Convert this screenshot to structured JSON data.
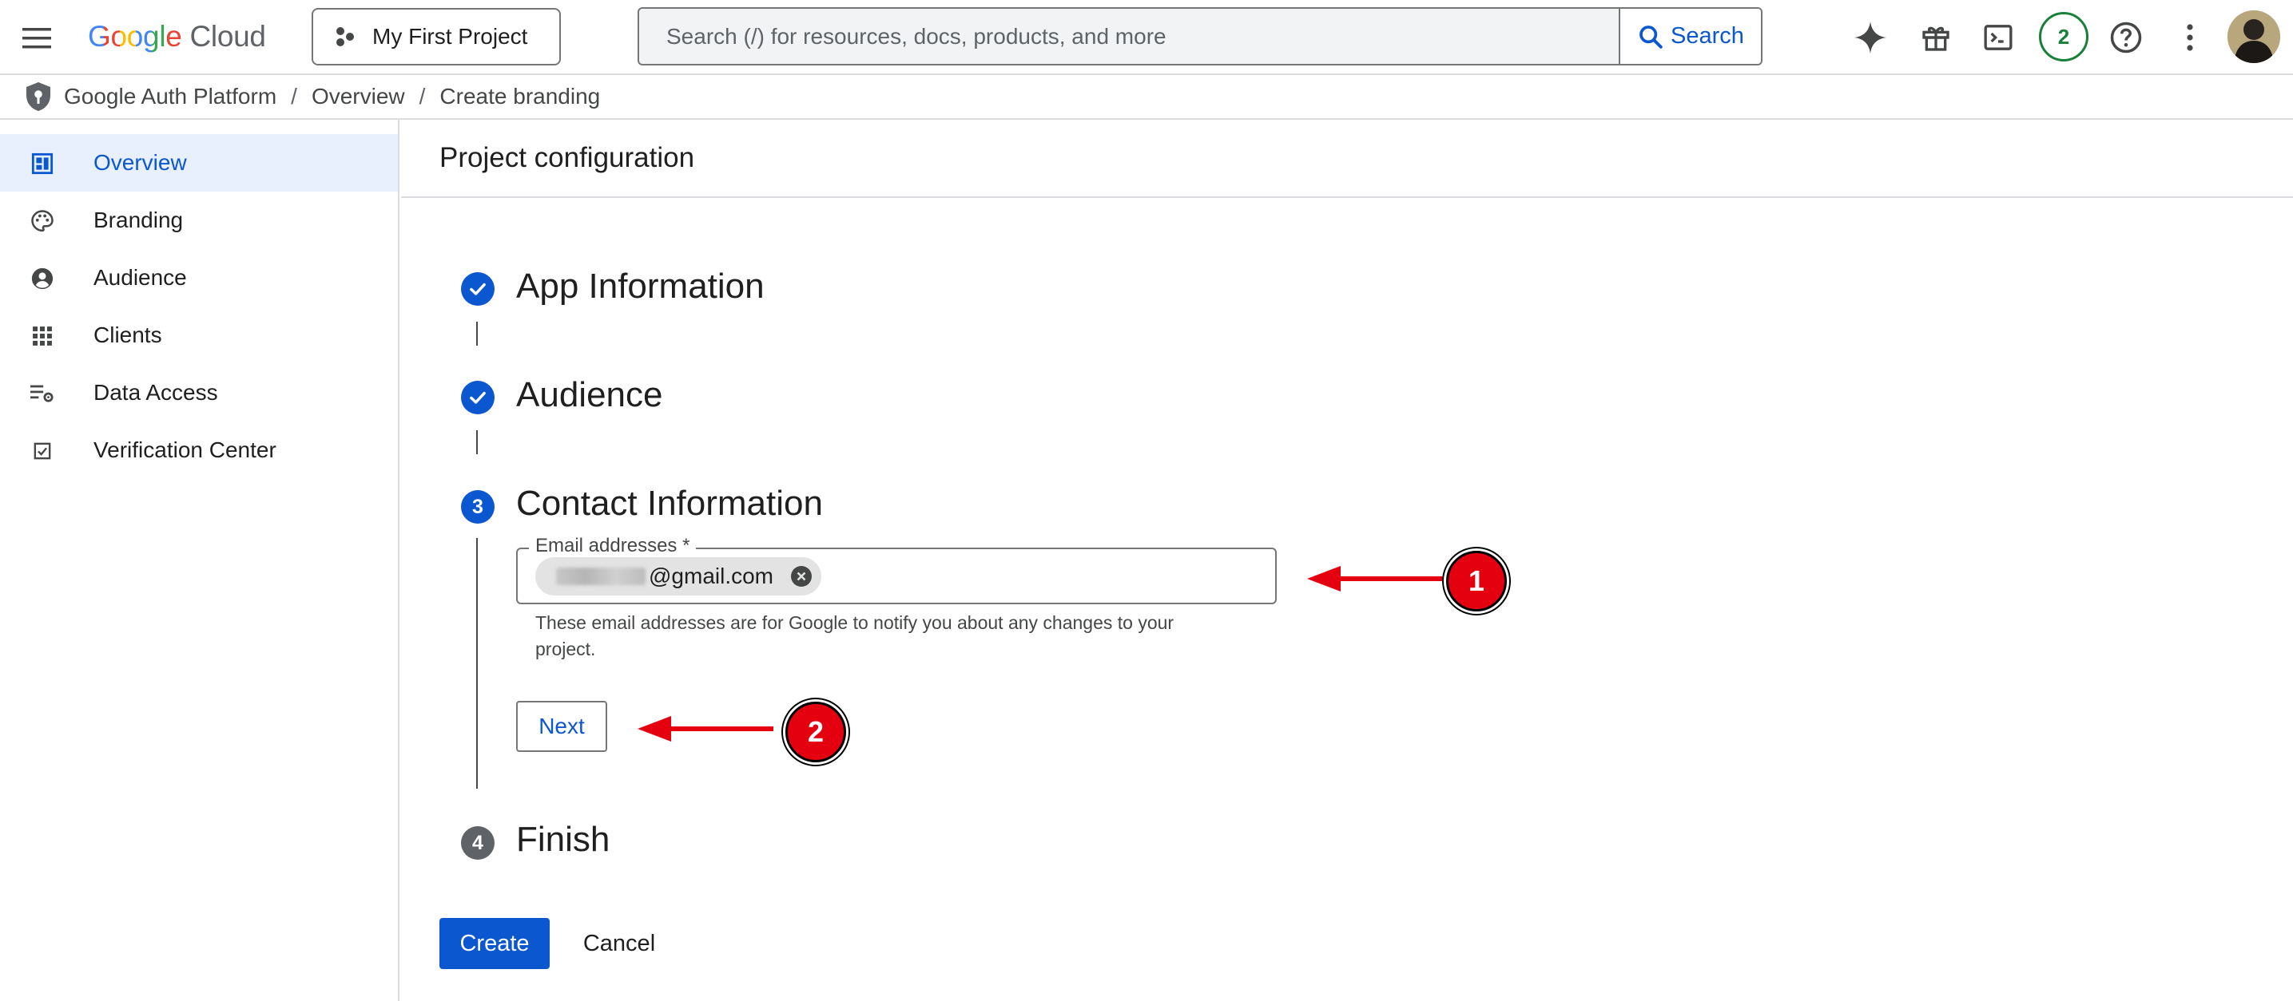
{
  "topbar": {
    "logo_word1": "Google",
    "logo_word2": "Cloud",
    "project_name": "My First Project",
    "search_placeholder": "Search (/) for resources, docs, products, and more",
    "search_button": "Search",
    "notifications_count": "2"
  },
  "breadcrumb": [
    "Google Auth Platform",
    "Overview",
    "Create branding"
  ],
  "breadcrumb_separator": "/",
  "sidebar": {
    "items": [
      {
        "label": "Overview",
        "icon": "dashboard-icon",
        "active": true
      },
      {
        "label": "Branding",
        "icon": "palette-icon",
        "active": false
      },
      {
        "label": "Audience",
        "icon": "account-circle-icon",
        "active": false
      },
      {
        "label": "Clients",
        "icon": "apps-grid-icon",
        "active": false
      },
      {
        "label": "Data Access",
        "icon": "data-settings-icon",
        "active": false
      },
      {
        "label": "Verification Center",
        "icon": "checkbox-icon",
        "active": false
      }
    ]
  },
  "main": {
    "title": "Project configuration",
    "steps": [
      {
        "title": "App Information",
        "state": "done"
      },
      {
        "title": "Audience",
        "state": "done"
      },
      {
        "number": "3",
        "title": "Contact Information",
        "state": "active"
      },
      {
        "number": "4",
        "title": "Finish",
        "state": "pending"
      }
    ],
    "email_field": {
      "label": "Email addresses *",
      "chip_value": "@gmail.com",
      "helper_text": "These email addresses are for Google to notify you about any changes to your project."
    },
    "next_button": "Next",
    "create_button": "Create",
    "cancel_button": "Cancel"
  },
  "annotations": [
    {
      "number": "1"
    },
    {
      "number": "2"
    }
  ],
  "colors": {
    "accent": "#0b57d0",
    "active_nav_bg": "#e8f0fe",
    "callout_red": "#e4000f",
    "notif_green": "#188038"
  }
}
